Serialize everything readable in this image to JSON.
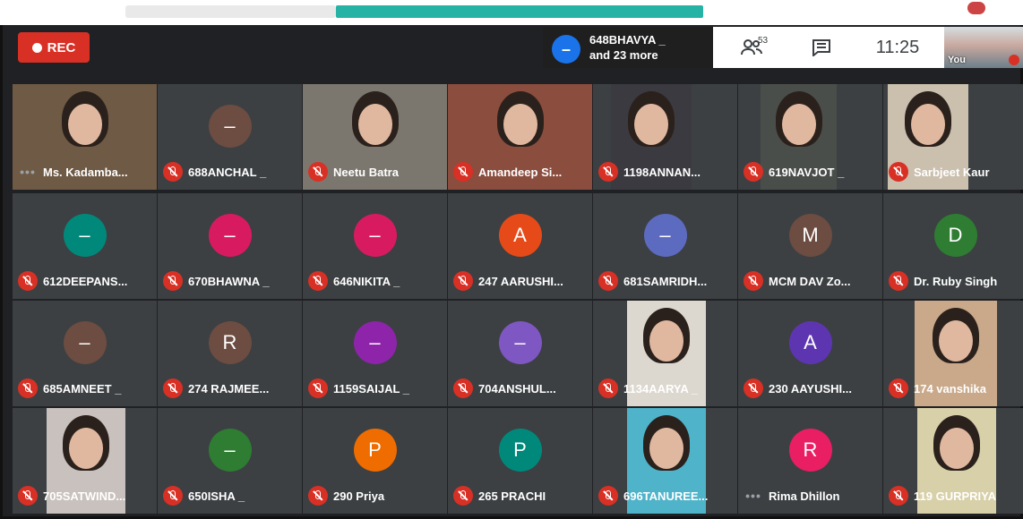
{
  "recording": {
    "label": "REC"
  },
  "presenter": {
    "line1": "648BHAVYA _",
    "line2": "and 23 more",
    "avatar": "–"
  },
  "toolbar": {
    "people_count": "53",
    "time": "11:25"
  },
  "self_tile": {
    "label": "You"
  },
  "colors": {
    "bg": "#202124",
    "tile": "#3c4043",
    "rec": "#d93025"
  },
  "participants": [
    {
      "name": "Ms. Kadamba...",
      "status": "speaking",
      "avatar": "",
      "type": "photo"
    },
    {
      "name": "688ANCHAL _",
      "status": "muted",
      "avatar": "–",
      "color": "#6d4c41",
      "type": "avatar"
    },
    {
      "name": "Neetu Batra",
      "status": "muted",
      "avatar": "",
      "type": "photo"
    },
    {
      "name": "Amandeep Si...",
      "status": "muted",
      "avatar": "",
      "type": "photo"
    },
    {
      "name": "1198ANNAN...",
      "status": "muted",
      "avatar": "",
      "type": "photo"
    },
    {
      "name": "619NAVJOT _",
      "status": "muted",
      "avatar": "",
      "type": "photo"
    },
    {
      "name": "Sarbjeet Kaur",
      "status": "muted",
      "avatar": "",
      "type": "photo"
    },
    {
      "name": "612DEEPANS...",
      "status": "muted",
      "avatar": "–",
      "color": "#00897b",
      "type": "avatar"
    },
    {
      "name": "670BHAWNA _",
      "status": "muted",
      "avatar": "–",
      "color": "#d81b60",
      "type": "avatar"
    },
    {
      "name": "646NIKITA _",
      "status": "muted",
      "avatar": "–",
      "color": "#d81b60",
      "type": "avatar"
    },
    {
      "name": "247 AARUSHI...",
      "status": "muted",
      "avatar": "A",
      "color": "#e64a19",
      "type": "avatar"
    },
    {
      "name": "681SAMRIDH...",
      "status": "muted",
      "avatar": "–",
      "color": "#5c6bc0",
      "type": "avatar"
    },
    {
      "name": "MCM DAV Zo...",
      "status": "muted",
      "avatar": "M",
      "color": "#6d4c41",
      "type": "avatar"
    },
    {
      "name": "Dr. Ruby Singh",
      "status": "muted",
      "avatar": "D",
      "color": "#2e7d32",
      "type": "avatar"
    },
    {
      "name": "685AMNEET _",
      "status": "muted",
      "avatar": "–",
      "color": "#6d4c41",
      "type": "avatar"
    },
    {
      "name": "274 RAJMEE...",
      "status": "muted",
      "avatar": "R",
      "color": "#6d4c41",
      "type": "avatar"
    },
    {
      "name": "1159SAIJAL _",
      "status": "muted",
      "avatar": "–",
      "color": "#8e24aa",
      "type": "avatar"
    },
    {
      "name": "704ANSHUL...",
      "status": "muted",
      "avatar": "–",
      "color": "#7e57c2",
      "type": "avatar"
    },
    {
      "name": "1134AARYA _",
      "status": "muted",
      "avatar": "",
      "type": "photo"
    },
    {
      "name": "230 AAYUSHI...",
      "status": "muted",
      "avatar": "A",
      "color": "#5e35b1",
      "type": "avatar"
    },
    {
      "name": "174 vanshika",
      "status": "muted",
      "avatar": "",
      "type": "photo"
    },
    {
      "name": "705SATWIND...",
      "status": "muted",
      "avatar": "",
      "type": "photo"
    },
    {
      "name": "650ISHA _",
      "status": "muted",
      "avatar": "–",
      "color": "#2e7d32",
      "type": "avatar"
    },
    {
      "name": "290 Priya",
      "status": "muted",
      "avatar": "P",
      "color": "#ef6c00",
      "type": "avatar"
    },
    {
      "name": "265 PRACHI",
      "status": "muted",
      "avatar": "P",
      "color": "#00897b",
      "type": "avatar"
    },
    {
      "name": "696TANUREE...",
      "status": "muted",
      "avatar": "",
      "type": "photo"
    },
    {
      "name": "Rima Dhillon",
      "status": "speaking",
      "avatar": "R",
      "color": "#e91e63",
      "type": "avatar"
    },
    {
      "name": "119 GURPRIYA",
      "status": "muted",
      "avatar": "",
      "type": "photo"
    }
  ]
}
